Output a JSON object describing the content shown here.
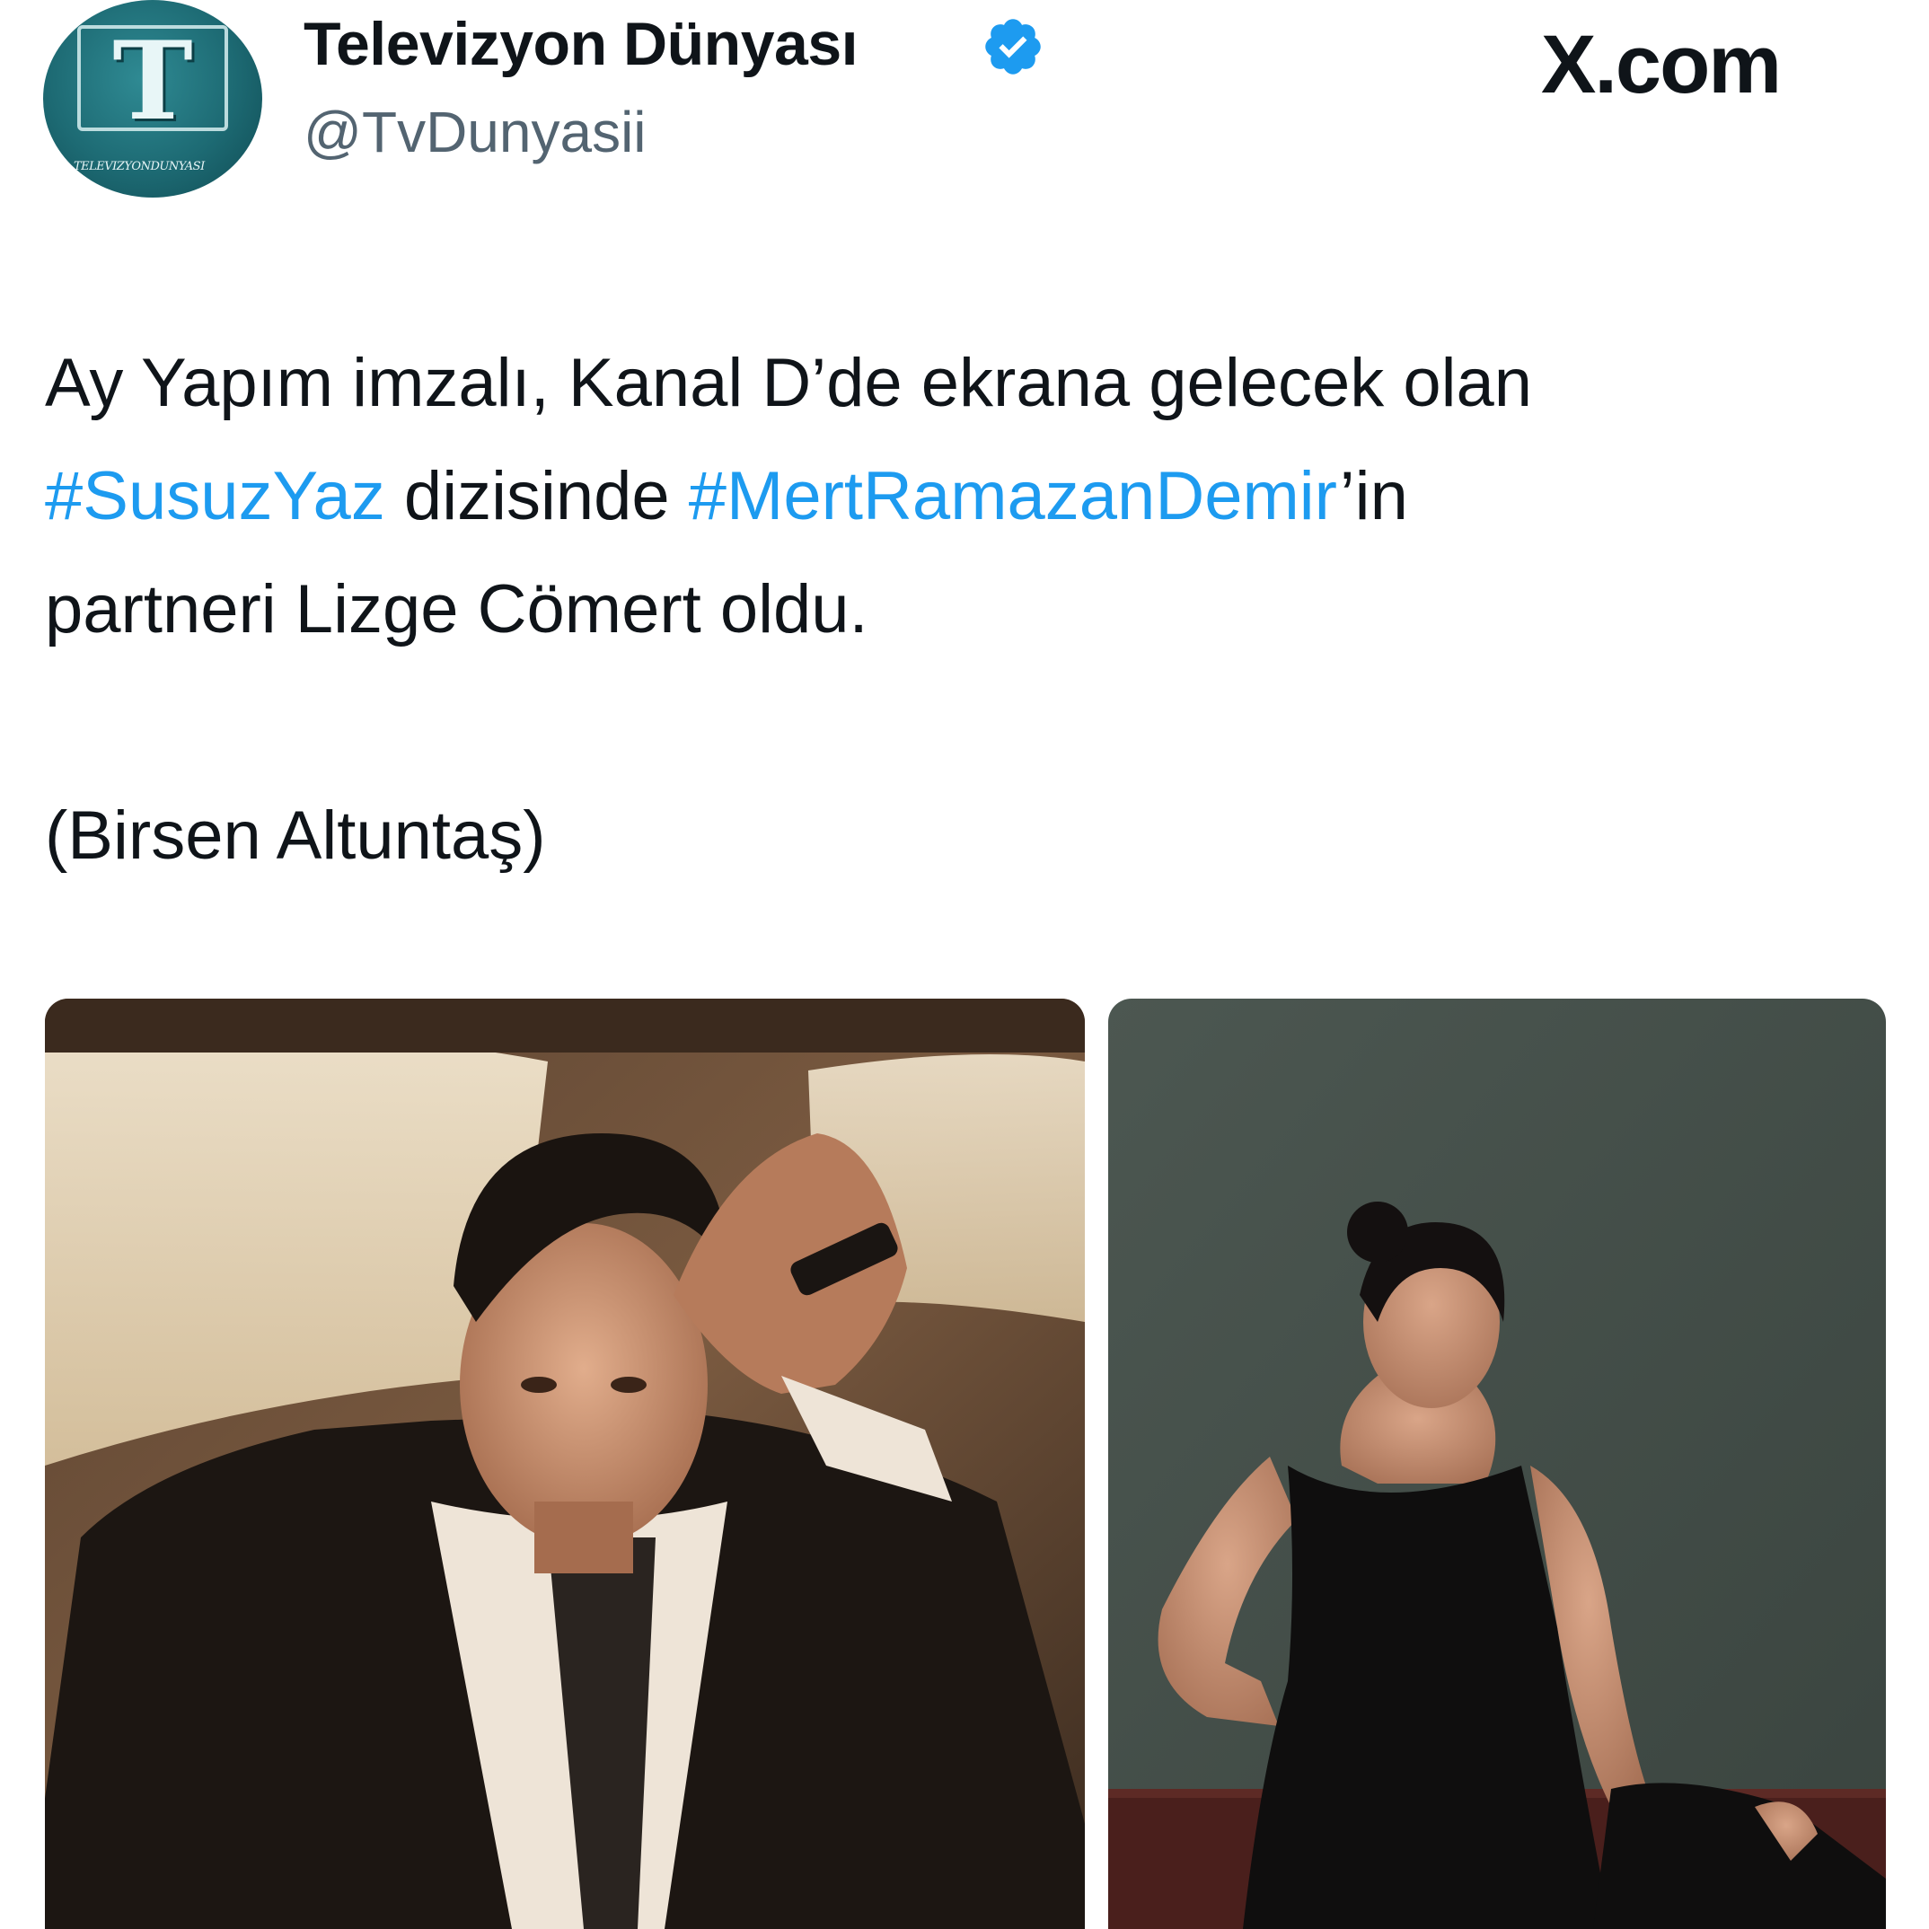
{
  "tweet": {
    "avatar_caption": "TELEVIZYONDUNYASI",
    "display_name": "Televizyon Dünyası",
    "handle": "@TvDunyasii",
    "verified": true,
    "brand": "X.com",
    "text_lines": [
      [
        {
          "text": "Ay Yapım imzalı, Kanal D’de ekrana gelecek olan",
          "type": "plain"
        }
      ],
      [
        {
          "text": "#SusuzYaz",
          "type": "hashtag"
        },
        {
          "text": " dizisinde ",
          "type": "plain"
        },
        {
          "text": "#MertRamazanDemir",
          "type": "hashtag"
        },
        {
          "text": "’in",
          "type": "plain"
        }
      ],
      [
        {
          "text": "partneri Lizge Cömert oldu.",
          "type": "plain"
        }
      ]
    ],
    "credit": "(Birsen Altuntaş)",
    "colors": {
      "text": "#0f1419",
      "secondary": "#536471",
      "hashtag": "#1d9bf0",
      "verified": "#1d9bf0"
    },
    "icons": {
      "verified": "verified-badge-icon",
      "avatar": "tv-logo-avatar"
    },
    "media": [
      {
        "kind": "photo",
        "description_icon": "man-in-car-photo"
      },
      {
        "kind": "photo",
        "description_icon": "woman-black-dress-photo"
      }
    ]
  }
}
